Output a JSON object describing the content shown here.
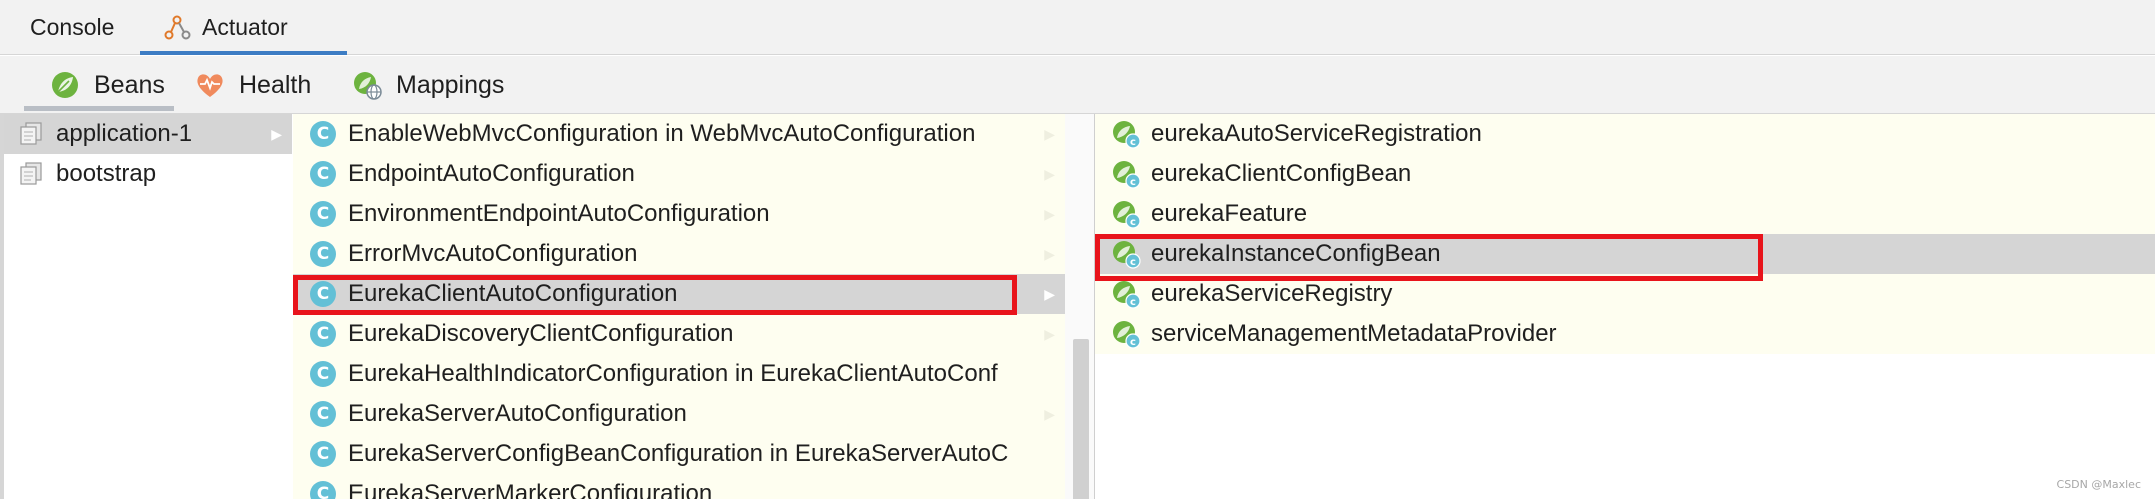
{
  "top_tabs": [
    {
      "label": "Console",
      "icon": "none",
      "active": false
    },
    {
      "label": "Actuator",
      "icon": "actuator-icon",
      "active": true
    }
  ],
  "sub_tabs": [
    {
      "label": "Beans",
      "icon": "spring-leaf-icon",
      "active": true
    },
    {
      "label": "Health",
      "icon": "heart-pulse-icon",
      "active": false
    },
    {
      "label": "Mappings",
      "icon": "spring-globe-icon",
      "active": false
    }
  ],
  "contexts": [
    {
      "label": "application-1",
      "selected": true
    },
    {
      "label": "bootstrap",
      "selected": false
    }
  ],
  "configurations": [
    {
      "label": "EnableWebMvcConfiguration in WebMvcAutoConfiguration",
      "selected": false
    },
    {
      "label": "EndpointAutoConfiguration",
      "selected": false
    },
    {
      "label": "EnvironmentEndpointAutoConfiguration",
      "selected": false
    },
    {
      "label": "ErrorMvcAutoConfiguration",
      "selected": false
    },
    {
      "label": "EurekaClientAutoConfiguration",
      "selected": true
    },
    {
      "label": "EurekaDiscoveryClientConfiguration",
      "selected": false
    },
    {
      "label": "EurekaHealthIndicatorConfiguration in EurekaClientAutoConf",
      "selected": false
    },
    {
      "label": "EurekaServerAutoConfiguration",
      "selected": false
    },
    {
      "label": "EurekaServerConfigBeanConfiguration in EurekaServerAutoC",
      "selected": false
    },
    {
      "label": "EurekaServerMarkerConfiguration",
      "selected": false
    }
  ],
  "class_icon_letter": "C",
  "beans": [
    {
      "label": "eurekaAutoServiceRegistration",
      "selected": false
    },
    {
      "label": "eurekaClientConfigBean",
      "selected": false
    },
    {
      "label": "eurekaFeature",
      "selected": false
    },
    {
      "label": "eurekaInstanceConfigBean",
      "selected": true
    },
    {
      "label": "eurekaServiceRegistry",
      "selected": false
    },
    {
      "label": "serviceManagementMetadataProvider",
      "selected": false
    }
  ],
  "colors": {
    "highlight_box": "#e8141b",
    "selection_bg": "#d5d5d5",
    "list_bg": "#fefef0",
    "class_icon": "#63c0d6",
    "spring_green": "#6db33f",
    "tab_underline": "#3d7dc4"
  },
  "watermark": "CSDN @Maxlec"
}
